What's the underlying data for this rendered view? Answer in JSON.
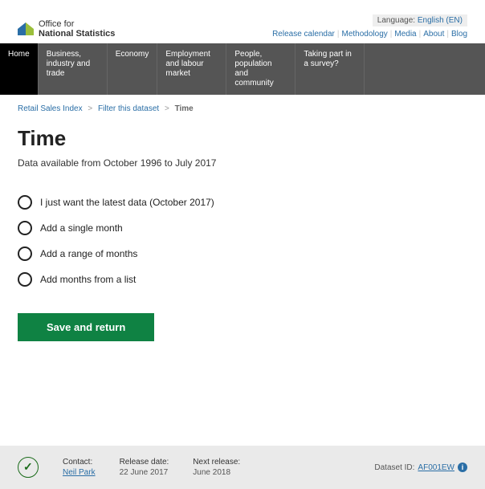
{
  "header": {
    "logo_line1": "Office for",
    "logo_line2": "National Statistics",
    "language_label": "Language:",
    "language_value": "English (EN)",
    "top_links": [
      "Release calendar",
      "Methodology",
      "Media",
      "About",
      "Blog"
    ]
  },
  "nav": [
    {
      "label": "Home",
      "active": true
    },
    {
      "label": "Business, industry and trade",
      "active": false
    },
    {
      "label": "Economy",
      "active": false
    },
    {
      "label": "Employment and labour market",
      "active": false
    },
    {
      "label": "People, population and community",
      "active": false
    },
    {
      "label": "Taking part in a survey?",
      "active": false
    }
  ],
  "breadcrumbs": {
    "items": [
      "Retail Sales Index",
      "Filter this dataset"
    ],
    "current": "Time"
  },
  "main": {
    "title": "Time",
    "subtext": "Data available from October 1996 to July 2017",
    "options": [
      "I just want the latest data (October 2017)",
      "Add a single month",
      "Add a range of months",
      "Add months from a list"
    ],
    "save_label": "Save and return"
  },
  "footer": {
    "contact_label": "Contact:",
    "contact_name": "Neil Park",
    "release_label": "Release date:",
    "release_value": "22 June 2017",
    "next_label": "Next release:",
    "next_value": "June 2018",
    "dataset_label": "Dataset ID:",
    "dataset_id": "AF001EW"
  }
}
